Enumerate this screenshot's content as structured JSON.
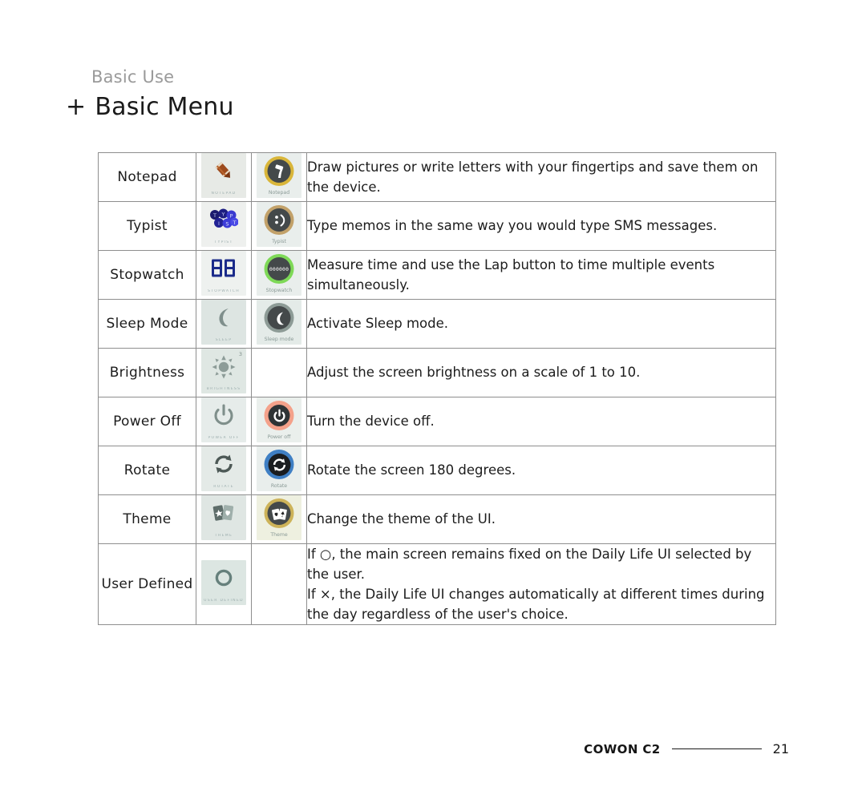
{
  "header": {
    "kicker": "Basic Use",
    "plus": "+",
    "title": "Basic Menu"
  },
  "table": {
    "rows": [
      {
        "name": "Notepad",
        "icon_caption": "NOTEPAD",
        "badge_caption": "Notepad",
        "icon": "pencil-icon",
        "badge_icon": "paint-roller-icon",
        "badge_ring_color": "#d9b63a",
        "badge_tile_bg": "#e9eeec",
        "tile_bg": "#e7eae6",
        "description": "Draw pictures or write letters with your fingertips and save them on the device."
      },
      {
        "name": "Typist",
        "icon_caption": "TYPIST",
        "badge_caption": "Typist",
        "icon": "keyboard-keys-icon",
        "badge_icon": "smiley-face-icon",
        "badge_ring_color": "#c2a169",
        "badge_tile_bg": "#e9eeec",
        "tile_bg": "#eef0ee",
        "description": "Type memos in the same way you would type SMS messages."
      },
      {
        "name": "Stopwatch",
        "icon_caption": "STOPWATCH",
        "badge_caption": "Stopwatch",
        "icon": "seven-segment-88-icon",
        "badge_icon": "stopwatch-digits-icon",
        "badge_digits": "000000",
        "badge_ring_color": "#7ed957",
        "badge_tile_bg": "#e9eeec",
        "tile_bg": "#eef1ef",
        "description": "Measure time and use the Lap button to time multiple events simultaneously."
      },
      {
        "name": "Sleep Mode",
        "icon_caption": "SLEEP",
        "badge_caption": "Sleep mode",
        "icon": "crescent-moon-icon",
        "badge_icon": "crescent-moon-icon",
        "badge_ring_color": "#8d9b96",
        "badge_tile_bg": "#e4ebe8",
        "tile_bg": "#dde5e2",
        "description": "Activate Sleep mode."
      },
      {
        "name": "Brightness",
        "icon_caption": "BRIGHTNESS",
        "badge_caption": "",
        "icon": "sun-brightness-icon",
        "badge_icon": "",
        "icon_level": "3",
        "badge_ring_color": "",
        "badge_tile_bg": "",
        "tile_bg": "#dfe7e3",
        "description": "Adjust the screen brightness on a scale of 1 to 10."
      },
      {
        "name": "Power Off",
        "icon_caption": "POWER OFF",
        "badge_caption": "Power off",
        "icon": "power-icon",
        "badge_icon": "power-icon",
        "badge_ring_color": "#f4a18a",
        "badge_tile_bg": "#eaefec",
        "tile_bg": "#e6ecea",
        "description": "Turn the device off."
      },
      {
        "name": "Rotate",
        "icon_caption": "ROTATE",
        "badge_caption": "Rotate",
        "icon": "rotate-arrows-icon",
        "badge_icon": "rotate-arrows-icon",
        "badge_ring_color": "#3f7fc4",
        "badge_tile_bg": "#e9eeec",
        "tile_bg": "#e4eae7",
        "description": "Rotate the screen 180 degrees."
      },
      {
        "name": "Theme",
        "icon_caption": "THEME",
        "badge_caption": "Theme",
        "icon": "playing-cards-icon",
        "badge_icon": "playing-cards-icon",
        "badge_ring_color": "#cdb359",
        "badge_tile_bg": "#eef0e0",
        "tile_bg": "#dfe6e3",
        "description": "If ○, the main screen remains fixed on the Daily Life UI selected by the user.\nIf ×, the Daily Life UI changes automatically at different times during the day regardless of the user's choice."
      },
      {
        "name": "User Defined",
        "icon_caption": "USER DEFINED",
        "badge_caption": "",
        "icon": "ring-circle-icon",
        "badge_icon": "",
        "badge_ring_color": "",
        "badge_tile_bg": "",
        "tile_bg": "#dce6e2",
        "description": ""
      }
    ],
    "descriptions": [
      "Draw pictures or write letters with your fingertips and save them on the device.",
      "Type memos in the same way you would type SMS messages.",
      "Measure time and use the Lap button to time multiple events simultaneously.",
      "Activate Sleep mode.",
      "Adjust the screen brightness on a scale of 1 to 10.",
      "Turn the device off.",
      "Rotate the screen 180 degrees.",
      "Change the theme of the UI.",
      "If ○, the main screen remains fixed on the Daily Life UI selected by the user.",
      "If ×, the Daily Life UI changes automatically at different times during the day regardless of the user's choice."
    ]
  },
  "footer": {
    "brand": "COWON C2",
    "page": "21"
  }
}
